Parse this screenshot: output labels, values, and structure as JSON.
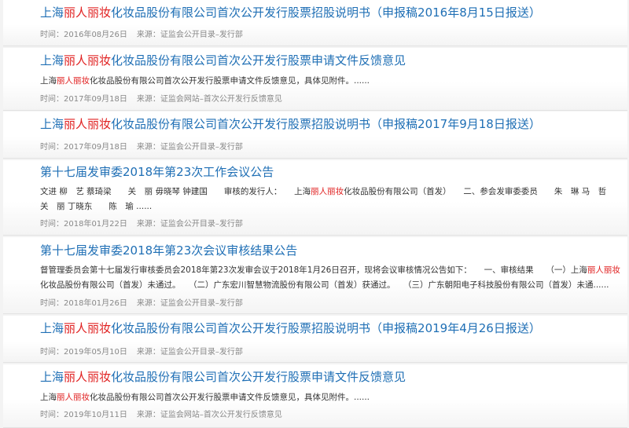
{
  "labels": {
    "time": "时间：",
    "source": "来源："
  },
  "items": [
    {
      "title_pre": "上海",
      "title_hl": "丽人丽妆",
      "title_post": "化妆品股份有限公司首次公开发行股票招股说明书（申报稿2016年8月15日报送）",
      "date": "2016年08月26日",
      "source": "证监会公开目录–发行部"
    },
    {
      "title_pre": "上海",
      "title_hl": "丽人丽妆",
      "title_post": "化妆品股份有限公司首次公开发行股票申请文件反馈意见",
      "snippet_pre": "上海",
      "snippet_hl": "丽人丽妆",
      "snippet_post": "化妆品股份有限公司首次公开发行股票申请文件反馈意见，具体见附件。......",
      "date": "2017年09月18日",
      "source": "证监会网站–首次公开发行反馈意见"
    },
    {
      "title_pre": "上海",
      "title_hl": "丽人丽妆",
      "title_post": "化妆品股份有限公司首次公开发行股票招股说明书（申报稿2017年9月18日报送）",
      "date": "2017年09月18日",
      "source": "证监会公开目录–发行部"
    },
    {
      "title": "第十七届发审委2018年第23次工作会议公告",
      "line1_a": "文进 柳　艺 蔡琦梁　　关　丽 毋晓琴 钟建国　　审核的发行人：　　上海",
      "line1_hl": "丽人丽妆",
      "line1_b": "化妆品股份有限公司（首发）　　二、参会发审委委员　　朱　琳 马　哲",
      "line2": "关　丽 丁晓东　　陈　瑜 ......",
      "date": "2018年01月22日",
      "source": "证监会公开目录–发行部"
    },
    {
      "title": "第十七届发审委2018年第23次会议审核结果公告",
      "line1_a": "督管理委员会第十七届发行审核委员会2018年第23次发审会议于2018年1月26日召开，现将会议审核情况公告如下：　　一、审核结果　　（一）上海",
      "line1_hl": "丽人丽妆",
      "line2": "化妆品股份有限公司（首发）未通过。　　（二）广东宏川智慧物流股份有限公司（首发）获通过。　　（三）广东朝阳电子科技股份有限公司（首发）未通......",
      "date": "2018年01月26日",
      "source": "证监会公开目录–发行部"
    },
    {
      "title_pre": "上海",
      "title_hl": "丽人丽妆",
      "title_post": "化妆品股份有限公司首次公开发行股票招股说明书（申报稿2019年4月26日报送）",
      "date": "2019年05月10日",
      "source": "证监会公开目录–发行部"
    },
    {
      "title_pre": "上海",
      "title_hl": "丽人丽妆",
      "title_post": "化妆品股份有限公司首次公开发行股票申请文件反馈意见",
      "snippet_pre": "上海",
      "snippet_hl": "丽人丽妆",
      "snippet_post": "化妆品股份有限公司首次公开发行股票申请文件反馈意见，具体见附件。......",
      "date": "2019年10月11日",
      "source": "证监会网站–首次公开发行反馈意见"
    }
  ]
}
